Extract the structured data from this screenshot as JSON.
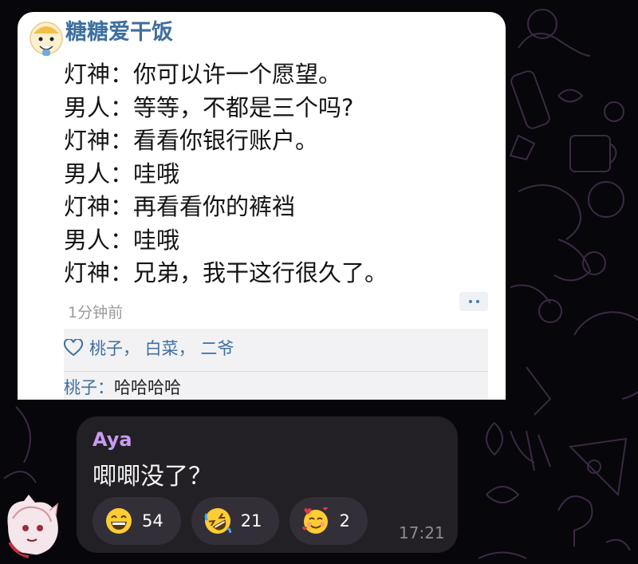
{
  "post": {
    "username": "糖糖爱干饭",
    "lines": [
      "灯神：你可以许一个愿望。",
      "男人：等等，不都是三个吗?",
      "灯神：看看你银行账户。",
      "男人：哇哦",
      "灯神：再看看你的裤裆",
      "男人：哇哦",
      "灯神：兄弟，我干这行很久了。"
    ],
    "time": "1分钟前",
    "likes": "桃子， 白菜， 二爷",
    "comment_user": "桃子：",
    "comment_text": "哈哈哈哈"
  },
  "chat": {
    "sender": "Aya",
    "message": "唧唧没了？",
    "timestamp": "17:21",
    "reactions": [
      {
        "emoji": "grinning-face",
        "count": "54"
      },
      {
        "emoji": "rolling-on-floor-laughing",
        "count": "21"
      },
      {
        "emoji": "smiling-face-with-hearts",
        "count": "2"
      }
    ]
  },
  "colors": {
    "background": "#07060a",
    "bubble": "#221f25",
    "sender_name": "#c99bf2",
    "link_blue": "#3e6f9f"
  }
}
